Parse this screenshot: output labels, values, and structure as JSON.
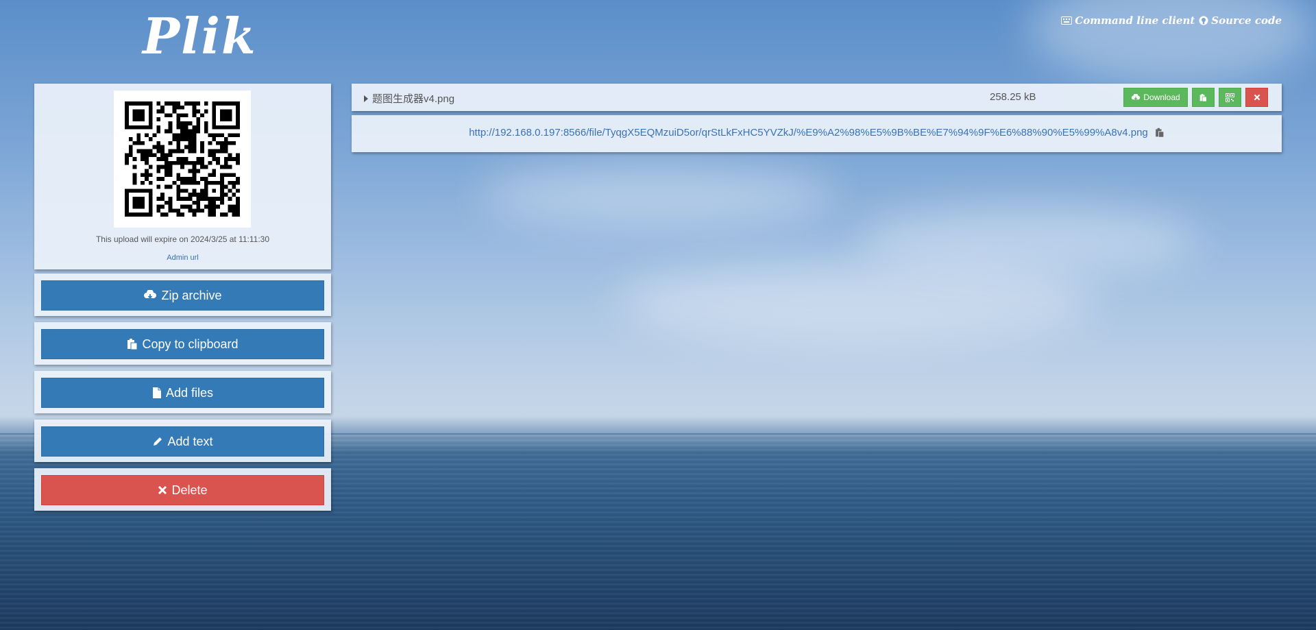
{
  "brand": {
    "logo": "Plik"
  },
  "top_links": {
    "cli": "Command line client",
    "source": "Source code"
  },
  "upload": {
    "expire_text": "This upload will expire on 2024/3/25 at 11:11:30",
    "admin_link": "Admin url"
  },
  "sidebar_buttons": {
    "zip": "Zip archive",
    "copy": "Copy to clipboard",
    "add_files": "Add files",
    "add_text": "Add text",
    "delete": "Delete"
  },
  "file": {
    "name": "题图生成器v4.png",
    "size": "258.25 kB",
    "download_label": "Download",
    "url": "http://192.168.0.197:8566/file/TyqgX5EQMzuiD5or/qrStLkFxHC5YVZkJ/%E9%A2%98%E5%9B%BE%E7%94%9F%E6%88%90%E5%99%A8v4.png"
  },
  "colors": {
    "primary": "#337ab7",
    "success": "#5cb85c",
    "danger": "#d9534f"
  }
}
